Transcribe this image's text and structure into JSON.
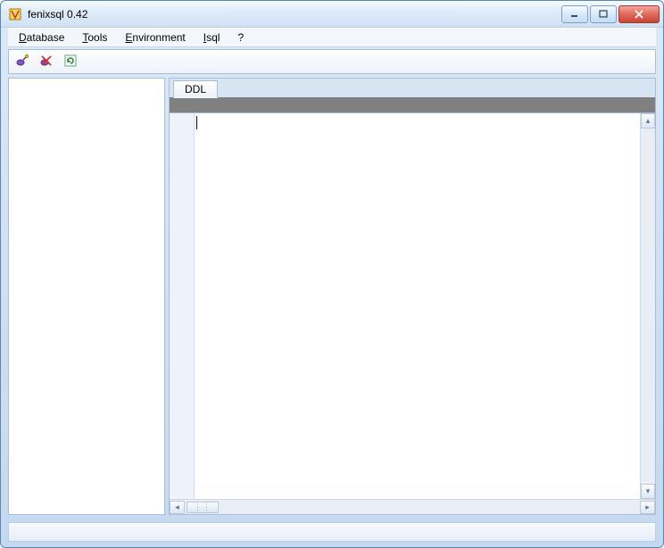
{
  "window": {
    "title": "fenixsql 0.42"
  },
  "menu": {
    "items": [
      "Database",
      "Tools",
      "Environment",
      "Isql",
      "?"
    ]
  },
  "toolbar": {
    "icons": [
      "connect-icon",
      "disconnect-icon",
      "refresh-icon"
    ]
  },
  "tabs": {
    "items": [
      {
        "label": "DDL"
      }
    ]
  },
  "editor": {
    "content": ""
  }
}
